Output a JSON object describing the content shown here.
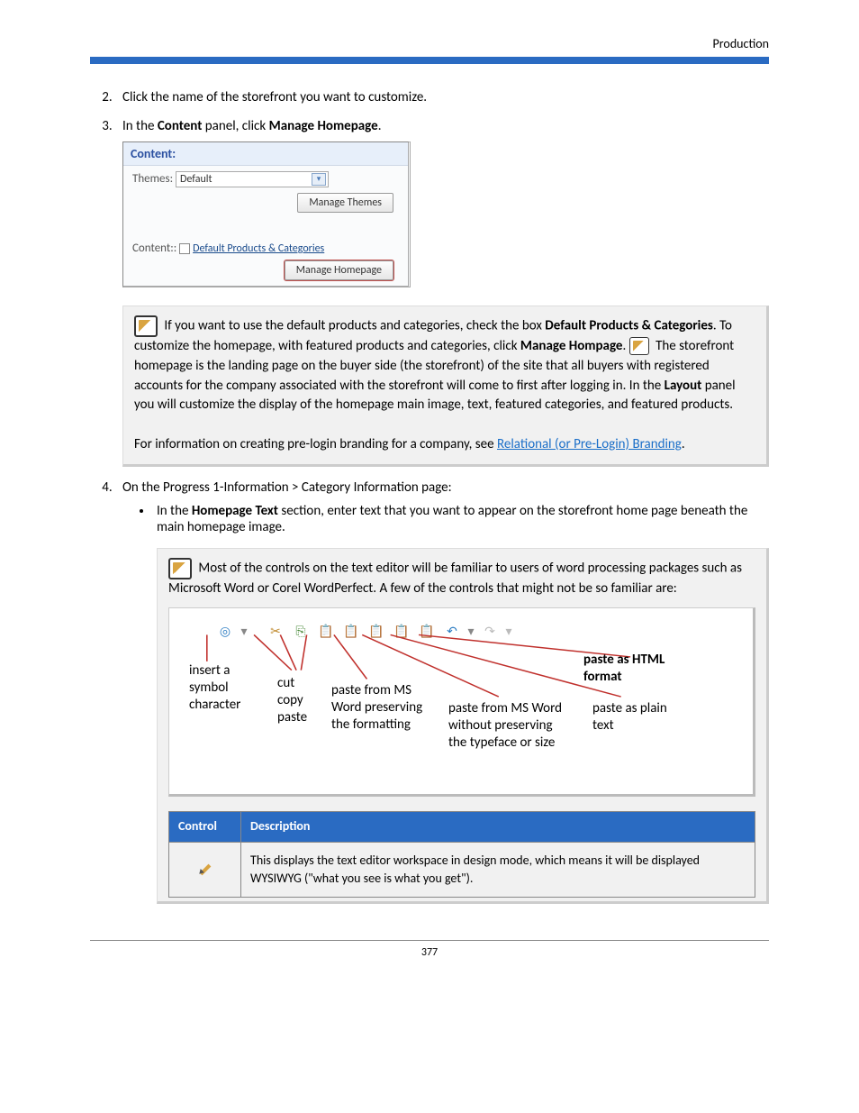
{
  "header": {
    "section": "Production"
  },
  "steps": {
    "s2": "Click the name of the storefront you want to customize.",
    "s3_prefix": "In the ",
    "s3_bold1": "Content",
    "s3_mid": " panel, click ",
    "s3_bold2": "Manage Homepage",
    "s3_suffix": "."
  },
  "panel": {
    "title": "Content:",
    "themesLabel": "Themes:",
    "themesValue": "Default",
    "manageThemesBtn": "Manage Themes",
    "contentLabel": "Content::",
    "defaultLink": "Default Products & Categories",
    "manageHomepageBtn": "Manage Homepage"
  },
  "note1": {
    "t1": "If you want to use the default products and categories, check the box ",
    "b1": "Default Products & Categories",
    "t2": ". To customize the homepage, with featured products and categories, click ",
    "b2": "Manage Hompage",
    "t3": ". ",
    "t4": "The storefront homepage is the landing page on the buyer side (the storefront) of the site that all buyers with registered accounts for the company associated with the storefront will come to first after logging in. In the ",
    "b3": "Layout",
    "t5": " panel you will customize the display of the homepage main image, text, featured categories, and featured products.",
    "t6": "For information on creating pre-login branding for a company, see ",
    "link": "Relational (or Pre-Login) Branding",
    "t7": "."
  },
  "step4": {
    "text": "On the Progress 1-Information > Category Information page:",
    "bullet_t1": "In the ",
    "bullet_b1": "Homepage Text",
    "bullet_t2": " section, enter text that you want to appear on the storefront home page beneath the main homepage image."
  },
  "note2": {
    "text": "Most of the controls on the text editor will be familiar to users of word processing packages such as Microsoft Word or Corel WordPerfect. A few of the controls that might not be so familiar are:"
  },
  "toolbar_labels": {
    "l1": "insert a symbol character",
    "l2": "cut copy paste",
    "l3": "paste from MS Word preserving the formatting",
    "l4": "paste from MS Word without preserving the typeface or size",
    "l5": "paste as plain text",
    "l6": "paste as HTML format"
  },
  "table": {
    "h1": "Control",
    "h2": "Description",
    "row1desc": "This displays the text editor workspace in design mode, which means it will be displayed WYSIWYG (\"what you see is what you get\")."
  },
  "footer": {
    "page": "377"
  },
  "chart_data": {
    "type": "table",
    "title": "Control / Description",
    "columns": [
      "Control",
      "Description"
    ],
    "rows": [
      [
        "pencil (design mode)",
        "This displays the text editor workspace in design mode, which means it will be displayed WYSIWYG (\"what you see is what you get\")."
      ]
    ]
  }
}
